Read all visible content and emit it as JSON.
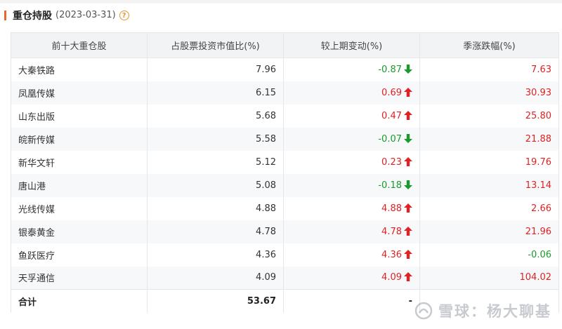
{
  "header": {
    "title": "重仓持股",
    "date": "(2023-03-31)",
    "help_icon": "question-circle-icon"
  },
  "colors": {
    "accent": "#e8672f",
    "up": "#e02222",
    "down": "#1a9a2a"
  },
  "table": {
    "columns": [
      "前十大重仓股",
      "占股票投资市值比(%)",
      "较上期变动(%)",
      "季涨跌幅(%)"
    ],
    "rows": [
      {
        "name": "大秦铁路",
        "ratio": "7.96",
        "change": "-0.87",
        "change_dir": "down",
        "rise": "7.63",
        "rise_dir": "up"
      },
      {
        "name": "凤凰传媒",
        "ratio": "6.15",
        "change": "0.69",
        "change_dir": "up",
        "rise": "30.93",
        "rise_dir": "up"
      },
      {
        "name": "山东出版",
        "ratio": "5.68",
        "change": "0.47",
        "change_dir": "up",
        "rise": "25.80",
        "rise_dir": "up"
      },
      {
        "name": "皖新传媒",
        "ratio": "5.58",
        "change": "-0.07",
        "change_dir": "down",
        "rise": "21.88",
        "rise_dir": "up"
      },
      {
        "name": "新华文轩",
        "ratio": "5.12",
        "change": "0.23",
        "change_dir": "up",
        "rise": "19.76",
        "rise_dir": "up"
      },
      {
        "name": "唐山港",
        "ratio": "5.08",
        "change": "-0.18",
        "change_dir": "down",
        "rise": "13.14",
        "rise_dir": "up"
      },
      {
        "name": "光线传媒",
        "ratio": "4.88",
        "change": "4.88",
        "change_dir": "up",
        "rise": "2.66",
        "rise_dir": "up"
      },
      {
        "name": "银泰黄金",
        "ratio": "4.78",
        "change": "4.78",
        "change_dir": "up",
        "rise": "21.96",
        "rise_dir": "up"
      },
      {
        "name": "鱼跃医疗",
        "ratio": "4.36",
        "change": "4.36",
        "change_dir": "up",
        "rise": "-0.06",
        "rise_dir": "down"
      },
      {
        "name": "天孚通信",
        "ratio": "4.09",
        "change": "4.09",
        "change_dir": "up",
        "rise": "104.02",
        "rise_dir": "up"
      }
    ],
    "total": {
      "label": "合计",
      "ratio": "53.67",
      "change": "-"
    }
  },
  "watermark": {
    "text": "雪球：杨大聊基",
    "logo_icon": "snowball-logo-icon"
  }
}
